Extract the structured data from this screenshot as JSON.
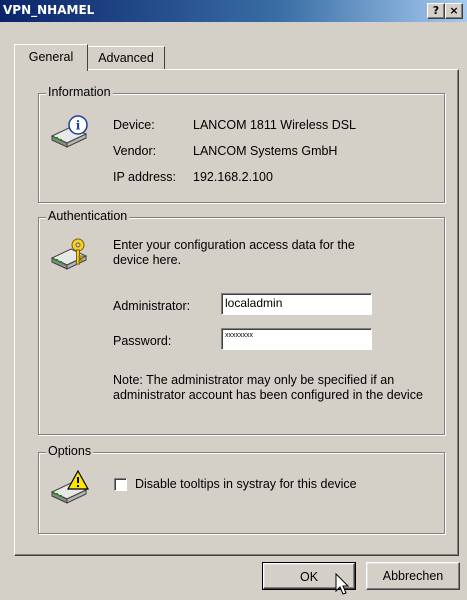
{
  "window": {
    "title": "VPN_NHAMEL",
    "help_label": "?",
    "close_label": "×"
  },
  "tabs": [
    {
      "label": "General"
    },
    {
      "label": "Advanced"
    }
  ],
  "information": {
    "legend": "Information",
    "device_label": "Device:",
    "device_value": "LANCOM 1811 Wireless DSL",
    "vendor_label": "Vendor:",
    "vendor_value": "LANCOM Systems GmbH",
    "ip_label": "IP address:",
    "ip_value": "192.168.2.100"
  },
  "authentication": {
    "legend": "Authentication",
    "intro": "Enter your configuration access data for the device here.",
    "admin_label": "Administrator:",
    "admin_value": "localadmin",
    "password_label": "Password:",
    "password_value": "xxxxxxxx",
    "note": "Note: The administrator may only be specified if an administrator account has been configured in the device"
  },
  "options": {
    "legend": "Options",
    "checkbox_label": "Disable tooltips in systray for this device",
    "checked": false
  },
  "buttons": {
    "ok": "OK",
    "cancel": "Abbrechen"
  }
}
